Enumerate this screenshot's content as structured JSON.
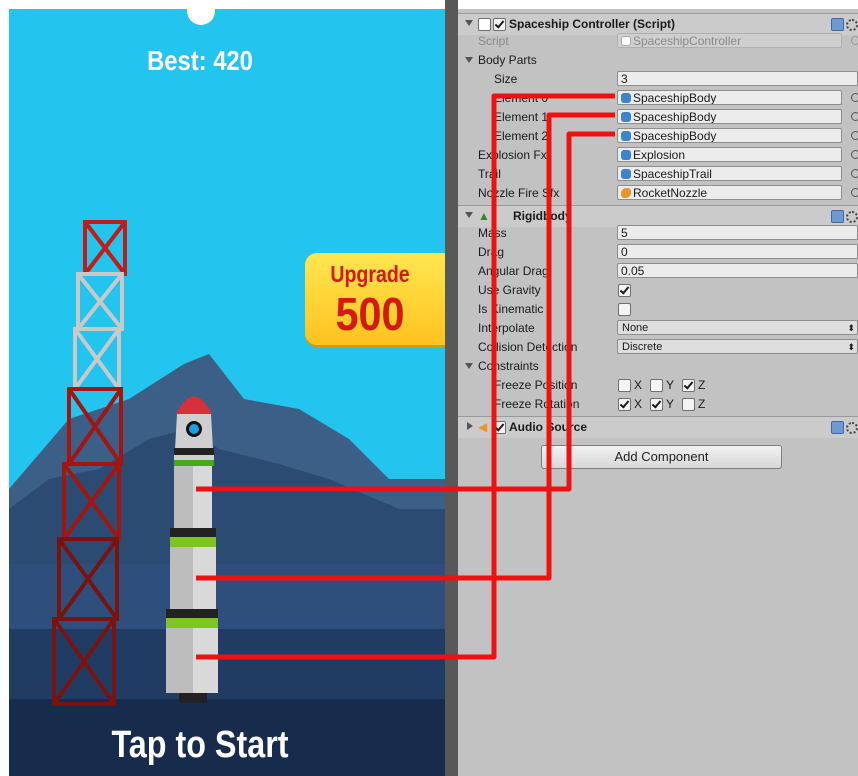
{
  "game": {
    "best_label": "Best: 420",
    "upgrade_label": "Upgrade",
    "upgrade_price": "500",
    "tap_to_start": "Tap to Start"
  },
  "inspector": {
    "script_component": {
      "title": "Spaceship Controller (Script)",
      "enabled": true,
      "script_label": "Script",
      "script_value": "SpaceshipController",
      "body_parts_label": "Body Parts",
      "size_label": "Size",
      "size_value": "3",
      "elements": [
        {
          "label": "Element 0",
          "value": "SpaceshipBody"
        },
        {
          "label": "Element 1",
          "value": "SpaceshipBody"
        },
        {
          "label": "Element 2",
          "value": "SpaceshipBody"
        }
      ],
      "explosion_label": "Explosion Fx",
      "explosion_value": "Explosion",
      "trail_label": "Trail",
      "trail_value": "SpaceshipTrail",
      "nozzle_label": "Nozzle Fire Sfx",
      "nozzle_value": "RocketNozzle"
    },
    "rigidbody": {
      "title": "Rigidbody",
      "mass_label": "Mass",
      "mass_value": "5",
      "drag_label": "Drag",
      "drag_value": "0",
      "angular_drag_label": "Angular Drag",
      "angular_drag_value": "0.05",
      "use_gravity_label": "Use Gravity",
      "use_gravity": true,
      "is_kinematic_label": "Is Kinematic",
      "is_kinematic": false,
      "interpolate_label": "Interpolate",
      "interpolate_value": "None",
      "collision_label": "Collision Detection",
      "collision_value": "Discrete",
      "constraints_label": "Constraints",
      "freeze_position_label": "Freeze Position",
      "freeze_position": {
        "x": false,
        "y": false,
        "z": true
      },
      "freeze_rotation_label": "Freeze Rotation",
      "freeze_rotation": {
        "x": true,
        "y": true,
        "z": false
      },
      "axis_x": "X",
      "axis_y": "Y",
      "axis_z": "Z"
    },
    "audio_source": {
      "title": "Audio Source",
      "enabled": true,
      "collapsed": true
    },
    "add_component_label": "Add Component"
  },
  "colors": {
    "sky": "#23c4ee",
    "annotation_line": "#ee1111",
    "upgrade_text": "#d21a10",
    "inspector_bg": "#c2c2c2"
  }
}
